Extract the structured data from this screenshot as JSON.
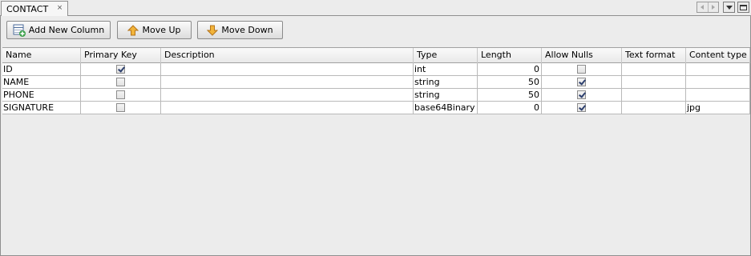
{
  "tab": {
    "title": "CONTACT",
    "close_icon": "close-icon"
  },
  "toolbar": {
    "add_label": "Add New Column",
    "up_label": "Move Up",
    "down_label": "Move Down"
  },
  "table": {
    "headers": [
      "Name",
      "Primary Key",
      "Description",
      "Type",
      "Length",
      "Allow Nulls",
      "Text format",
      "Content type"
    ],
    "rows": [
      {
        "name": "ID",
        "primary_key": true,
        "description": "",
        "type": "int",
        "length": "0",
        "allow_nulls": false,
        "text_format": "",
        "content_type": ""
      },
      {
        "name": "NAME",
        "primary_key": false,
        "description": "",
        "type": "string",
        "length": "50",
        "allow_nulls": true,
        "text_format": "",
        "content_type": ""
      },
      {
        "name": "PHONE",
        "primary_key": false,
        "description": "",
        "type": "string",
        "length": "50",
        "allow_nulls": true,
        "text_format": "",
        "content_type": ""
      },
      {
        "name": "SIGNATURE",
        "primary_key": false,
        "description": "",
        "type": "base64Binary",
        "length": "0",
        "allow_nulls": true,
        "text_format": "",
        "content_type": "jpg"
      }
    ]
  },
  "colors": {
    "accent_icon": "#3aa04a",
    "arrow_icon": "#f0a020",
    "panel_bg": "#ececec",
    "border": "#8f8f8f"
  }
}
